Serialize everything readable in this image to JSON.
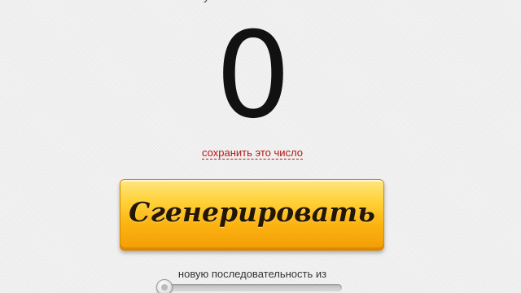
{
  "header": {
    "fragment_text": "у"
  },
  "result": {
    "number": "0",
    "save_link_label": "сохранить это число"
  },
  "generate_button": {
    "label": "Сгенерировать"
  },
  "sequence": {
    "label": "новую последовательность из"
  },
  "colors": {
    "background": "#efefef",
    "link": "#b01515",
    "button_top": "#ffe681",
    "button_bottom": "#f39c06"
  }
}
